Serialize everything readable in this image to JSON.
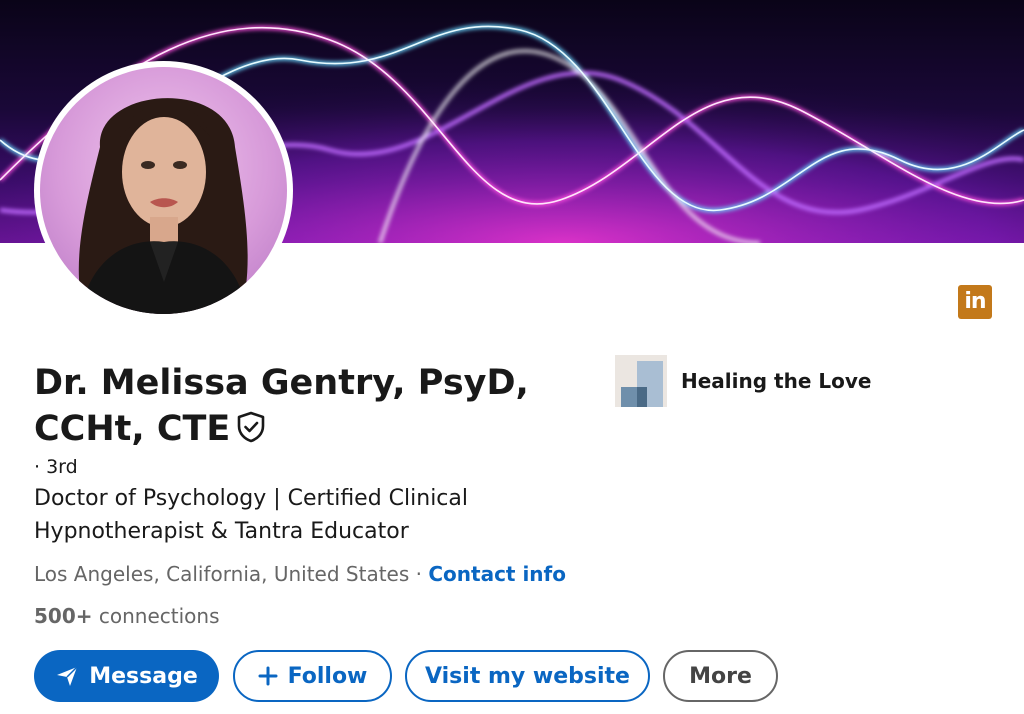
{
  "profile": {
    "name": "Dr. Melissa Gentry, PsyD, CCHt, CTE",
    "degree": "· 3rd",
    "headline": "Doctor of Psychology | Certified Clinical Hypnotherapist & Tantra Educator",
    "location": "Los Angeles, California, United States",
    "location_separator": " · ",
    "contact_info": "Contact info",
    "connections_count": "500+",
    "connections_label": " connections"
  },
  "company": {
    "name": "Healing the Love"
  },
  "badge": {
    "text": "in"
  },
  "actions": {
    "message": "Message",
    "follow": "Follow",
    "website": "Visit my website",
    "more": "More"
  },
  "icons": {
    "message": "send-icon",
    "follow": "plus-icon",
    "verified": "verified-shield-icon",
    "linkedin": "linkedin-icon"
  },
  "colors": {
    "primary": "#0a66c2",
    "text": "#191919",
    "muted": "#666666",
    "badge": "#c3791a"
  }
}
